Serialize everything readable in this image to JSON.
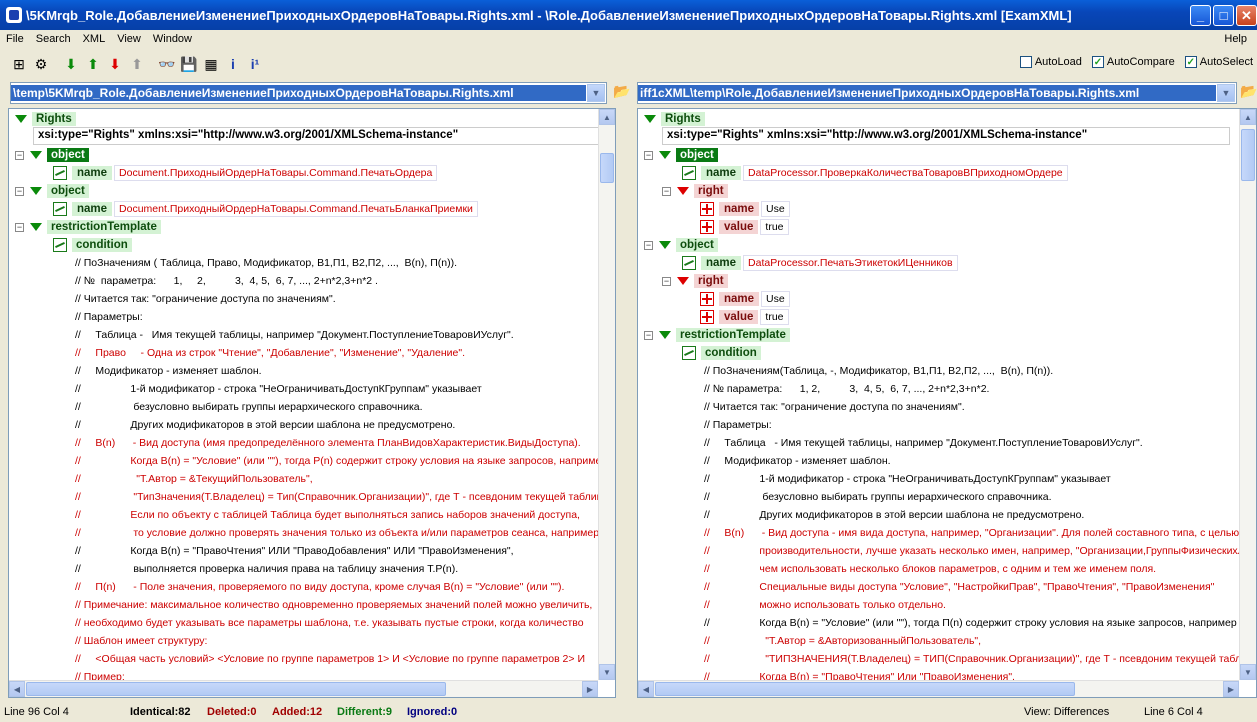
{
  "window": {
    "title": "\\5KMrqb_Role.ДобавлениеИзменениеПриходныхОрдеровНаТовары.Rights.xml - \\Role.ДобавлениеИзменениеПриходныхОрдеровНаТовары.Rights.xml [ExamXML]",
    "min": "_",
    "max": "□",
    "close": "✕"
  },
  "menu": [
    "File",
    "Search",
    "XML",
    "View",
    "Window"
  ],
  "menu_help": "Help",
  "options": {
    "autoload": {
      "label": "AutoLoad",
      "checked": false
    },
    "autocompare": {
      "label": "AutoCompare",
      "checked": true
    },
    "autoselect": {
      "label": "AutoSelect",
      "checked": true
    }
  },
  "left": {
    "path": "\\temp\\5KMrqb_Role.ДобавлениеИзменениеПриходныхОрдеровНаТовары.Rights.xml",
    "root": "Rights",
    "xsi": "xsi:type=\"Rights\" xmlns:xsi=\"http://www.w3.org/2001/XMLSchema-instance\"",
    "obj1": "object",
    "name1_label": "name",
    "name1_value": "Document.ПриходныйОрдерНаТовары.Command.ПечатьОрдера",
    "obj2": "object",
    "name2_label": "name",
    "name2_value": "Document.ПриходныйОрдерНаТовары.Command.ПечатьБланкаПриемки",
    "restriction": "restrictionTemplate",
    "condition": "condition",
    "lines": [
      {
        "t": "// ПоЗначениям ( Таблица, Право, Модификатор, В1,П1, В2,П2, ...,  В(n), П(n)).",
        "r": false
      },
      {
        "t": "// №  параметра:      1,     2,          3,  4, 5,  6, 7, ..., 2+n*2,3+n*2 .",
        "r": false
      },
      {
        "t": "// Читается так: \"ограничение доступа по значениям\".",
        "r": false
      },
      {
        "t": "// Параметры:",
        "r": false
      },
      {
        "t": "//     Таблица -   Имя текущей таблицы, например \"Документ.ПоступлениеТоваровИУслуг\".",
        "r": false
      },
      {
        "t": "//     Право     - Одна из строк \"Чтение\", \"Добавление\", \"Изменение\", \"Удаление\".",
        "r": true
      },
      {
        "t": "//     Модификатор - изменяет шаблон.",
        "r": false
      },
      {
        "t": "//                 1-й модификатор - строка \"НеОграничиватьДоступКГруппам\" указывает",
        "r": false
      },
      {
        "t": "//                  безусловно выбирать группы иерархического справочника.",
        "r": false
      },
      {
        "t": "//                 Других модификаторов в этой версии шаблона не предусмотрено.",
        "r": false
      },
      {
        "t": "//     В(n)      - Вид доступа (имя предопределённого элемента ПланВидовХарактеристик.ВидыДоступа).",
        "r": true
      },
      {
        "t": "//                 Когда В(n) = \"Условие\" (или \"\"), тогда Р(n) содержит строку условия на языке запросов, например",
        "r": true
      },
      {
        "t": "//                   \"Т.Автор = &ТекущийПользователь\",",
        "r": true
      },
      {
        "t": "//                  \"ТипЗначения(Т.Владелец) = Тип(Справочник.Организации)\", где Т - псевдоним текущей таблицы",
        "r": true
      },
      {
        "t": "//                 Если по объекту с таблицей Таблица будет выполняться запись наборов значений доступа,",
        "r": true
      },
      {
        "t": "//                  то условие должно проверять значения только из объекта и/или параметров сеанса, например",
        "r": true
      },
      {
        "t": "//                 Когда В(n) = \"ПравоЧтения\" ИЛИ \"ПравоДобавления\" ИЛИ \"ПравоИзменения\",",
        "r": false
      },
      {
        "t": "//                  выполняется проверка наличия права на таблицу значения Т.Р(n).",
        "r": false
      },
      {
        "t": "//     П(n)      - Поле значения, проверяемого по виду доступа, кроме случая В(n) = \"Условие\" (или \"\").",
        "r": true
      },
      {
        "t": "// Примечание: максимальное количество одновременно проверяемых значений полей можно увеличить,",
        "r": true
      },
      {
        "t": "// необходимо будет указывать все параметры шаблона, т.е. указывать пустые строки, когда количество",
        "r": true
      },
      {
        "t": "// Шаблон имеет структуру:",
        "r": true
      },
      {
        "t": "//     <Общая часть условий> <Условие по группе параметров 1> И <Условие по группе параметров 2> И",
        "r": true
      },
      {
        "t": "// Пример:",
        "r": true
      }
    ]
  },
  "right": {
    "path": "iff1cXML\\temp\\Role.ДобавлениеИзменениеПриходныхОрдеровНаТовары.Rights.xml",
    "root": "Rights",
    "xsi": "xsi:type=\"Rights\" xmlns:xsi=\"http://www.w3.org/2001/XMLSchema-instance\"",
    "obj1": "object",
    "name1_label": "name",
    "name1_value": "DataProcessor.ПроверкаКоличестваТоваровВПриходномОрдере",
    "right1": "right",
    "r1_name_label": "name",
    "r1_name_value": "Use",
    "r1_value_label": "value",
    "r1_value_value": "true",
    "obj2": "object",
    "name2_label": "name",
    "name2_value": "DataProcessor.ПечатьЭтикетокИЦенников",
    "right2": "right",
    "r2_name_label": "name",
    "r2_name_value": "Use",
    "r2_value_label": "value",
    "r2_value_value": "true",
    "restriction": "restrictionTemplate",
    "condition": "condition",
    "lines": [
      {
        "t": "// ПоЗначениям(Таблица, -, Модификатор, В1,П1, В2,П2, ...,  В(n), П(n)).",
        "r": false
      },
      {
        "t": "// № параметра:      1, 2,          3,  4, 5,  6, 7, ..., 2+n*2,3+n*2.",
        "r": false
      },
      {
        "t": "// Читается так: \"ограничение доступа по значениям\".",
        "r": false
      },
      {
        "t": "// Параметры:",
        "r": false
      },
      {
        "t": "//     Таблица   - Имя текущей таблицы, например \"Документ.ПоступлениеТоваровИУслуг\".",
        "r": false
      },
      {
        "t": "//     Модификатор - изменяет шаблон.",
        "r": false
      },
      {
        "t": "//                 1-й модификатор - строка \"НеОграничиватьДоступКГруппам\" указывает",
        "r": false
      },
      {
        "t": "//                  безусловно выбирать группы иерархического справочника.",
        "r": false
      },
      {
        "t": "//                 Других модификаторов в этой версии шаблона не предусмотрено.",
        "r": false
      },
      {
        "t": "//     В(n)      - Вид доступа - имя вида доступа, например, \"Организации\". Для полей составного типа, с целью",
        "r": true
      },
      {
        "t": "//                 производительности, лучше указать несколько имен, например, \"Организации,ГруппыФизическихЛиц\"",
        "r": true
      },
      {
        "t": "//                 чем использовать несколько блоков параметров, с одним и тем же именем поля.",
        "r": true
      },
      {
        "t": "//                 Специальные виды доступа \"Условие\", \"НастройкиПрав\", \"ПравоЧтения\", \"ПравоИзменения\"",
        "r": true
      },
      {
        "t": "//                 можно использовать только отдельно.",
        "r": true
      },
      {
        "t": "//                 Когда В(n) = \"Условие\" (или \"\"), тогда П(n) содержит строку условия на языке запросов, например",
        "r": false
      },
      {
        "t": "//                   \"Т.Автор = &АвторизованныйПользователь\",",
        "r": true
      },
      {
        "t": "//                   \"ТИПЗНАЧЕНИЯ(Т.Владелец) = ТИП(Справочник.Организации)\", где Т - псевдоним текущей таблицы",
        "r": true
      },
      {
        "t": "//                 Когда В(n) = \"ПравоЧтения\" Или \"ПравоИзменения\",",
        "r": true
      }
    ]
  },
  "status": {
    "left_pos": "Line 96  Col 4",
    "identical": "Identical:82",
    "deleted": "Deleted:0",
    "added": "Added:12",
    "different": "Different:9",
    "ignored": "Ignored:0",
    "view": "View: Differences",
    "right_pos": "Line 6  Col 4"
  },
  "colors": {
    "identical": "#000000",
    "deleted": "#a00000",
    "added": "#a00000",
    "different": "#0a7a14",
    "ignored": "#000080"
  }
}
